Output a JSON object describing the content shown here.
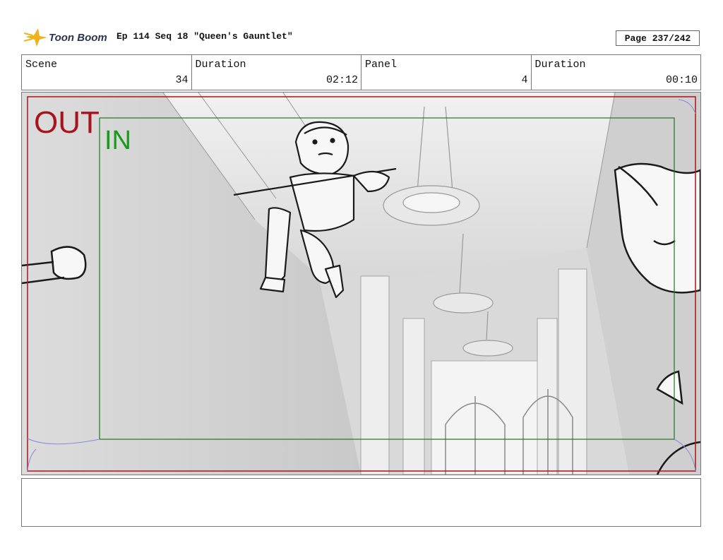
{
  "header": {
    "logo_text": "Toon Boom",
    "episode_title": "Ep 114 Seq 18 \"Queen's Gauntlet\"",
    "page": "Page 237/242"
  },
  "info": {
    "scene_label": "Scene",
    "scene_value": "34",
    "scene_duration_label": "Duration",
    "scene_duration_value": "02:12",
    "panel_label": "Panel",
    "panel_value": "4",
    "panel_duration_label": "Duration",
    "panel_duration_value": "00:10"
  },
  "panel": {
    "out_label": "OUT",
    "in_label": "IN",
    "colors": {
      "out_frame": "#a8141c",
      "in_frame": "#1a7a1a"
    }
  },
  "notes": {
    "text": ""
  }
}
